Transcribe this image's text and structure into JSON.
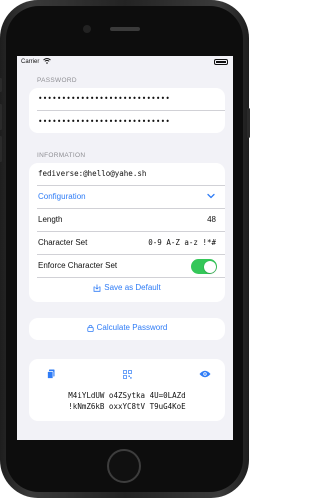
{
  "status_bar": {
    "carrier": "Carrier",
    "time": ""
  },
  "password_section": {
    "header": "PASSWORD",
    "master_password_dots": "••••••••••••••••••••••••••••",
    "confirm_password_dots": "••••••••••••••••••••••••••••"
  },
  "information_section": {
    "header": "INFORMATION",
    "site_value": "fediverse:@hello@yahe.sh",
    "configuration_label": "Configuration",
    "length_label": "Length",
    "length_value": "48",
    "charset_label": "Character Set",
    "charset_value": "0-9 A-Z a-z !*#",
    "enforce_label": "Enforce Character Set",
    "enforce_on": true,
    "save_default_label": "Save as Default"
  },
  "calculate_button_label": "Calculate Password",
  "result": {
    "line1": "M4iYLdUW o4ZSytka 4U=0LAZd",
    "line2": "!kNmZ6kB oxxYC8tV T9uG4KoE"
  },
  "colors": {
    "accent": "#2f7cf6",
    "toggle_on": "#34c759",
    "background": "#f2f2f7"
  },
  "icons": [
    "wifi-icon",
    "battery-icon",
    "chevron-down-icon",
    "save-icon",
    "lock-icon",
    "copy-icon",
    "qr-code-icon",
    "eye-icon"
  ]
}
